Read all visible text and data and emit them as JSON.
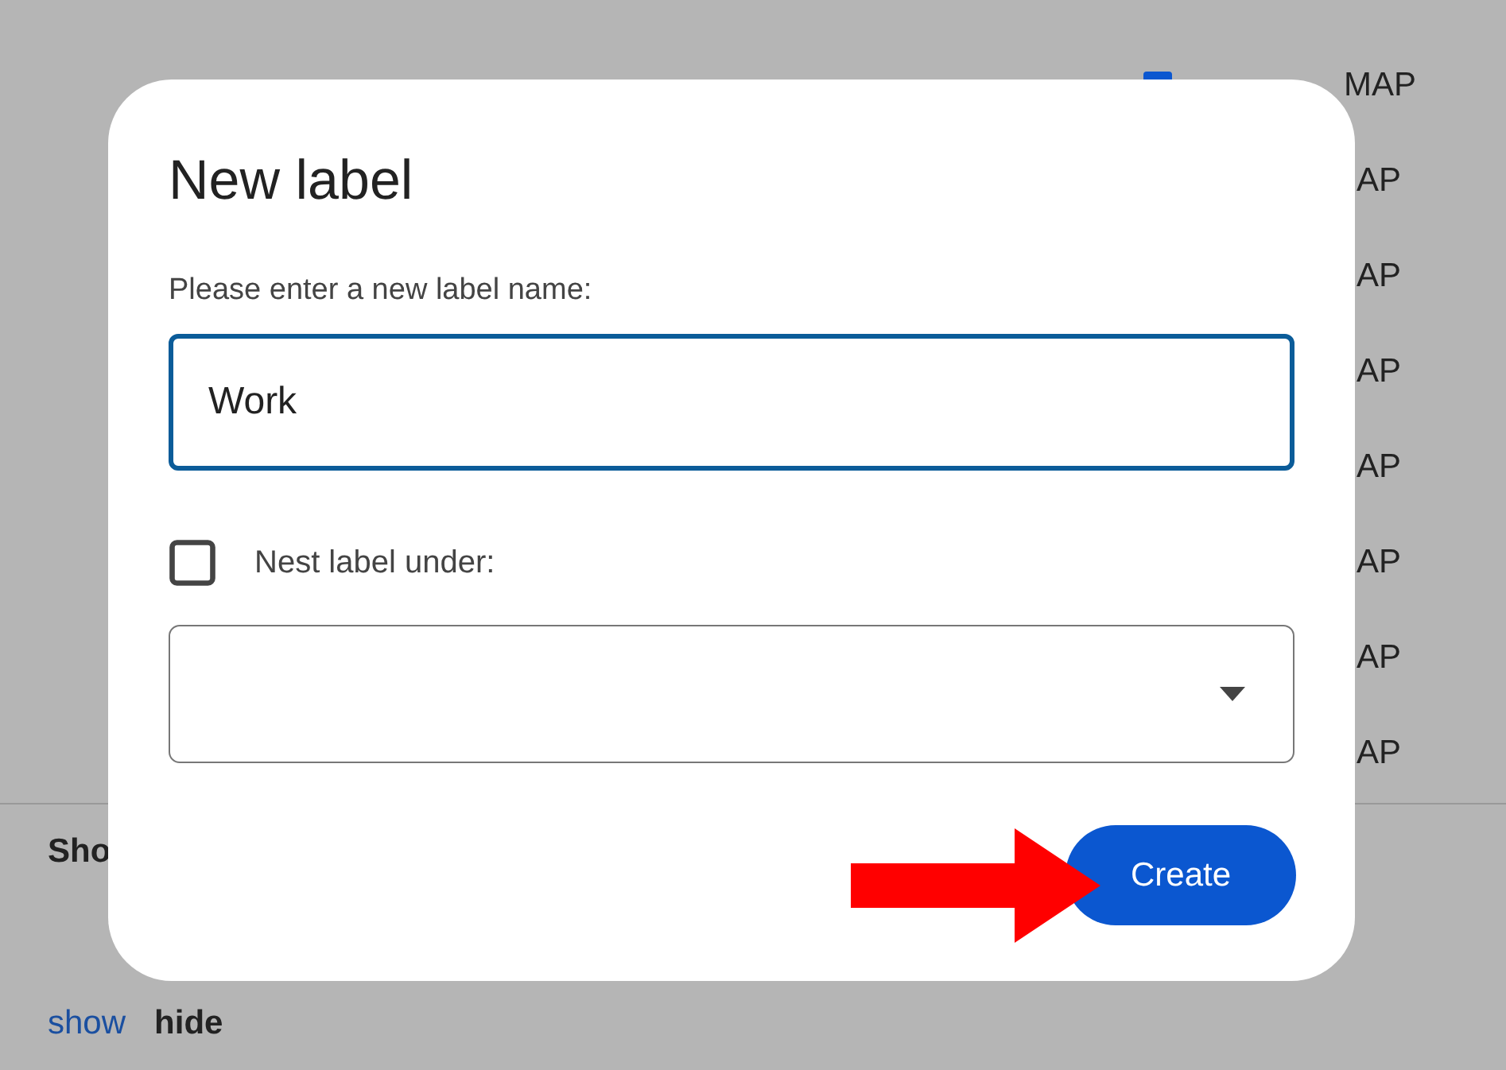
{
  "background": {
    "imap_rows": [
      {
        "kind": "partial",
        "checked": true,
        "label": "MAP"
      },
      {
        "kind": "text",
        "label": "AP"
      },
      {
        "kind": "text",
        "label": "AP"
      },
      {
        "kind": "text",
        "label": "AP"
      },
      {
        "kind": "text",
        "label": "AP"
      },
      {
        "kind": "text",
        "label": "AP"
      },
      {
        "kind": "text",
        "label": "AP"
      },
      {
        "kind": "text",
        "label": "AP"
      }
    ],
    "section_heading": "Sho",
    "links": [
      {
        "label": "show",
        "selected": false
      },
      {
        "label": "hide",
        "selected": true
      }
    ]
  },
  "dialog": {
    "title": "New label",
    "prompt": "Please enter a new label name:",
    "name_field": {
      "value": "Work"
    },
    "nest": {
      "checked": false,
      "label": "Nest label under:"
    },
    "create_button": "Create"
  }
}
